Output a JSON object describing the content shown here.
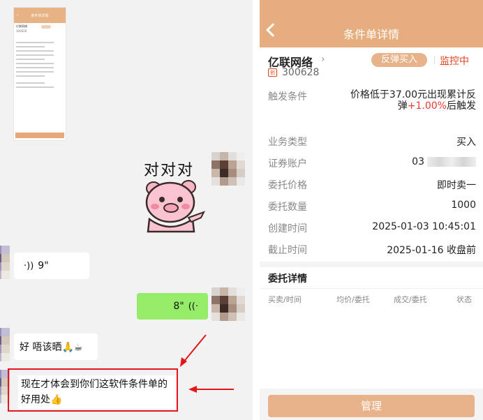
{
  "chat": {
    "sticker_text": "对对对",
    "voice_in": "9\"",
    "voice_out": "8\"",
    "reply_text": "好 唔该晒🙏☕",
    "highlight_text": "现在才体会到你们这软件条件单的好用处👍"
  },
  "app": {
    "title": "条件单详情",
    "stock_name": "亿联网络",
    "market_tag": "创",
    "stock_code": "300628",
    "order_type_badge": "反弹买入",
    "status": "监控中",
    "trigger_label": "触发条件",
    "trigger_prefix": "价格低于37.00元出现累计反弹",
    "trigger_pct": "+1.00%",
    "trigger_suffix": "后触发",
    "rows": [
      {
        "label": "业务类型",
        "value": "买入"
      },
      {
        "label": "证券账户",
        "value": "03"
      },
      {
        "label": "委托价格",
        "value": "即时卖一"
      },
      {
        "label": "委托数量",
        "value": "1000"
      },
      {
        "label": "创建时间",
        "value": "2025-01-03 10:45:01"
      },
      {
        "label": "截止时间",
        "value": "2025-01-16 收盘前"
      }
    ],
    "entrust_title": "委托详情",
    "entrust_cols": [
      "买卖/时间",
      "均价/委托",
      "成交/委托",
      "状态"
    ],
    "manage_label": "管理"
  },
  "thumb": {
    "title": "条件单详情",
    "stock": "亿联网络",
    "code": "300628",
    "manage": "管理"
  },
  "colors": {
    "header": "#e6ad7f",
    "accent_red": "#f0392e",
    "wechat_green": "#95ec69",
    "annotation_red": "#e5161b"
  }
}
